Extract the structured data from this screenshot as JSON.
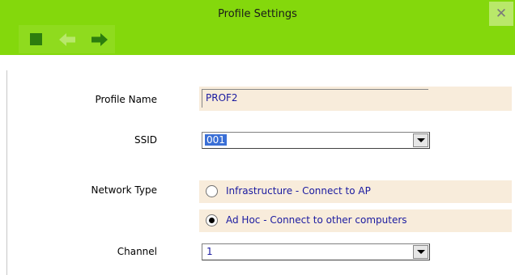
{
  "window": {
    "title": "Profile Settings",
    "close_glyph": "✕"
  },
  "toolbar": {
    "buttons": [
      {
        "icon": "stop-icon"
      },
      {
        "icon": "back-arrow-icon"
      },
      {
        "icon": "forward-arrow-icon"
      }
    ]
  },
  "form": {
    "profile_name": {
      "label": "Profile Name",
      "value": "PROF2"
    },
    "ssid": {
      "label": "SSID",
      "value": "001"
    },
    "network_type": {
      "label": "Network Type",
      "options": [
        {
          "label": "Infrastructure - Connect to AP",
          "checked": false
        },
        {
          "label": "Ad Hoc - Connect to other computers",
          "checked": true
        }
      ]
    },
    "channel": {
      "label": "Channel",
      "value": "1"
    }
  },
  "colors": {
    "titlebar": "#84d80c",
    "toolbar_icon": "#2d7d0e",
    "field_background": "#f8ecdb",
    "value_text": "#1a1aa0",
    "selection": "#3a6fd6"
  }
}
